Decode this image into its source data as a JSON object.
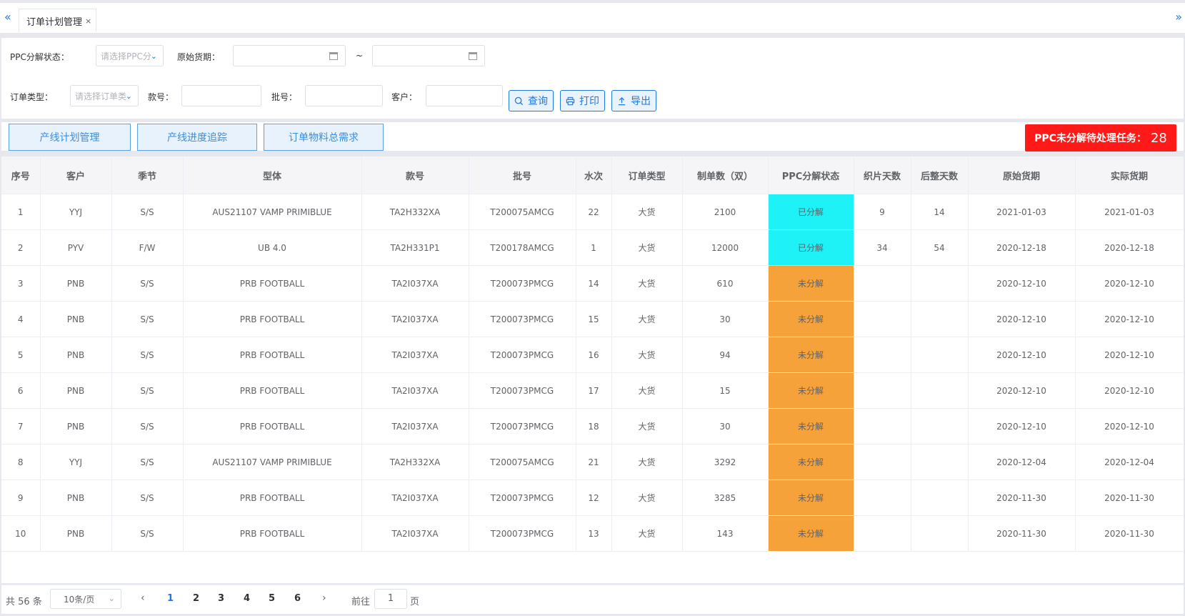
{
  "tabs": {
    "active_label": "订单计划管理",
    "close_symbol": "×",
    "left_arrow": "«",
    "right_arrow": "»"
  },
  "filters": {
    "ppc_status_label": "PPC分解状态：",
    "ppc_status_placeholder": "请选择PPC分",
    "delivery_date_label": "原始货期：",
    "date_separator": "~",
    "order_type_label": "订单类型：",
    "order_type_placeholder": "请选择订单类",
    "style_no_label": "款号：",
    "batch_no_label": "批号：",
    "customer_label": "客户："
  },
  "buttons": {
    "query": "查询",
    "print": "打印",
    "export": "导出"
  },
  "toolbar": {
    "line_plan": "产线计划管理",
    "line_progress": "产线进度追踪",
    "order_material": "订单物料总需求"
  },
  "ppc_badge": {
    "label": "PPC未分解待处理任务：",
    "count": "28",
    "color": "#ff1a1a"
  },
  "table": {
    "columns": [
      "序号",
      "客户",
      "季节",
      "型体",
      "款号",
      "批号",
      "水次",
      "订单类型",
      "制单数（双）",
      "PPC分解状态",
      "织片天数",
      "后整天数",
      "原始货期",
      "实际货期"
    ],
    "status_colors": {
      "已分解": "#1ef2f7",
      "未分解": "#f5a23a"
    },
    "rows": [
      [
        "1",
        "YYJ",
        "S/S",
        "AUS21107 VAMP PRIMIBLUE",
        "TA2H332XA",
        "T200075AMCG",
        "22",
        "大货",
        "2100",
        "已分解",
        "9",
        "14",
        "2021-01-03",
        "2021-01-03"
      ],
      [
        "2",
        "PYV",
        "F/W",
        "UB 4.0",
        "TA2H331P1",
        "T200178AMCG",
        "1",
        "大货",
        "12000",
        "已分解",
        "34",
        "54",
        "2020-12-18",
        "2020-12-18"
      ],
      [
        "3",
        "PNB",
        "S/S",
        "PRB FOOTBALL",
        "TA2I037XA",
        "T200073PMCG",
        "14",
        "大货",
        "610",
        "未分解",
        "",
        "",
        "2020-12-10",
        "2020-12-10"
      ],
      [
        "4",
        "PNB",
        "S/S",
        "PRB FOOTBALL",
        "TA2I037XA",
        "T200073PMCG",
        "15",
        "大货",
        "30",
        "未分解",
        "",
        "",
        "2020-12-10",
        "2020-12-10"
      ],
      [
        "5",
        "PNB",
        "S/S",
        "PRB FOOTBALL",
        "TA2I037XA",
        "T200073PMCG",
        "16",
        "大货",
        "94",
        "未分解",
        "",
        "",
        "2020-12-10",
        "2020-12-10"
      ],
      [
        "6",
        "PNB",
        "S/S",
        "PRB FOOTBALL",
        "TA2I037XA",
        "T200073PMCG",
        "17",
        "大货",
        "15",
        "未分解",
        "",
        "",
        "2020-12-10",
        "2020-12-10"
      ],
      [
        "7",
        "PNB",
        "S/S",
        "PRB FOOTBALL",
        "TA2I037XA",
        "T200073PMCG",
        "18",
        "大货",
        "30",
        "未分解",
        "",
        "",
        "2020-12-10",
        "2020-12-10"
      ],
      [
        "8",
        "YYJ",
        "S/S",
        "AUS21107 VAMP PRIMIBLUE",
        "TA2H332XA",
        "T200075AMCG",
        "21",
        "大货",
        "3292",
        "未分解",
        "",
        "",
        "2020-12-04",
        "2020-12-04"
      ],
      [
        "9",
        "PNB",
        "S/S",
        "PRB FOOTBALL",
        "TA2I037XA",
        "T200073PMCG",
        "12",
        "大货",
        "3285",
        "未分解",
        "",
        "",
        "2020-11-30",
        "2020-11-30"
      ],
      [
        "10",
        "PNB",
        "S/S",
        "PRB FOOTBALL",
        "TA2I037XA",
        "T200073PMCG",
        "13",
        "大货",
        "143",
        "未分解",
        "",
        "",
        "2020-11-30",
        "2020-11-30"
      ]
    ]
  },
  "pagination": {
    "total_text": "共 56 条",
    "page_size": "10条/页",
    "prev_symbol": "‹",
    "next_symbol": "›",
    "pages": [
      "1",
      "2",
      "3",
      "4",
      "5",
      "6"
    ],
    "current_page": "1",
    "goto_label": "前往",
    "goto_value": "1",
    "page_suffix": "页"
  },
  "icons": {
    "search": "search-icon",
    "print": "printer-icon",
    "export": "upload-icon",
    "calendar": "calendar-icon",
    "dropdown": "chevron-down-icon"
  }
}
